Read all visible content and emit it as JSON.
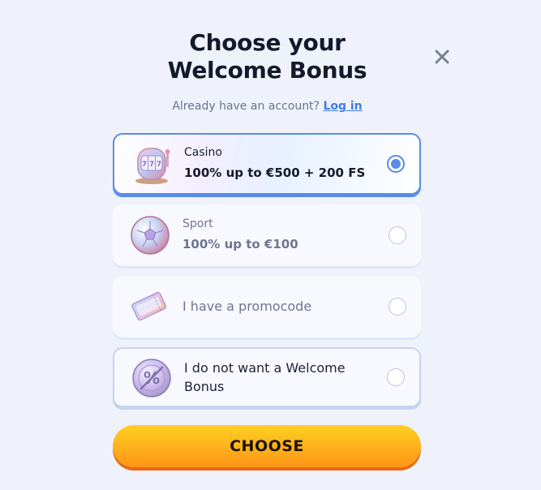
{
  "dialog": {
    "title_line1": "Choose your",
    "title_line2": "Welcome Bonus",
    "account_prompt": "Already have an account?",
    "login_link": "Log in",
    "choose_button": "CHOOSE"
  },
  "options": [
    {
      "label": "Casino",
      "offer": "100% up to €500 + 200 FS",
      "selected": true,
      "icon": "slot-machine-icon"
    },
    {
      "label": "Sport",
      "offer": "100% up to €100",
      "selected": false,
      "icon": "soccer-ball-icon"
    },
    {
      "label": "I have a promocode",
      "selected": false,
      "icon": "ticket-icon"
    },
    {
      "label": "I do not want a Welcome Bonus",
      "selected": false,
      "icon": "no-bonus-coin-icon"
    }
  ],
  "colors": {
    "accent": "#5a8be8",
    "link": "#3d7de8",
    "button_top": "#ffd023",
    "button_bottom": "#ff9516",
    "background": "#eff2fb"
  }
}
